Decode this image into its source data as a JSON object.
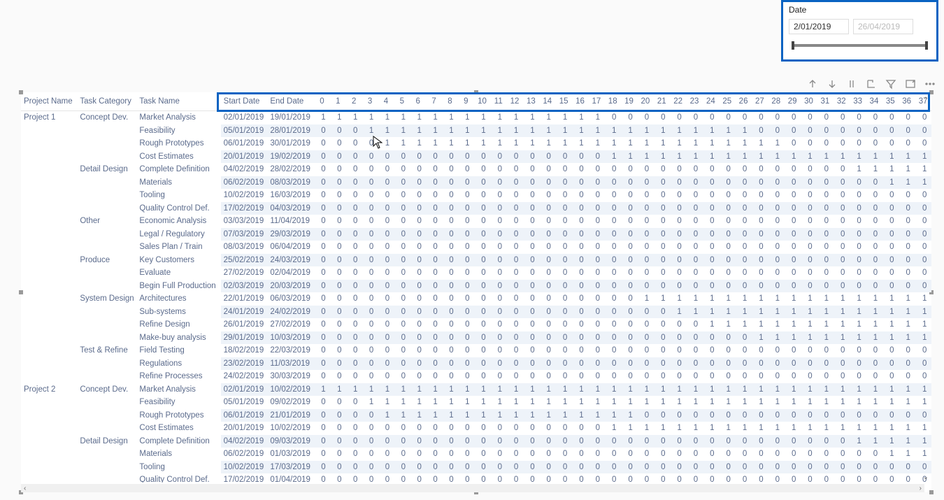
{
  "slicer": {
    "label": "Date",
    "start": "2/01/2019",
    "end": "26/04/2019"
  },
  "toolbar_icons": [
    "drill-up",
    "drill-down-on",
    "expand-down",
    "drill-through",
    "show-data",
    "focus-mode",
    "filter",
    "copy",
    "more"
  ],
  "headers": {
    "project": "Project Name",
    "category": "Task Category",
    "task": "Task Name",
    "start": "Start Date",
    "end": "End Date"
  },
  "num_cols": [
    "0",
    "1",
    "2",
    "3",
    "4",
    "5",
    "6",
    "7",
    "8",
    "9",
    "10",
    "11",
    "12",
    "13",
    "14",
    "15",
    "16",
    "17",
    "18",
    "19",
    "20",
    "21",
    "22",
    "23",
    "24",
    "25",
    "26",
    "27",
    "28",
    "29",
    "30",
    "31",
    "32",
    "33",
    "34",
    "35",
    "36",
    "37"
  ],
  "rows": [
    {
      "pn": "Project 1",
      "cat": "Concept Dev.",
      "task": "Market Analysis",
      "sd": "02/01/2019",
      "ed": "19/01/2019",
      "alt": false,
      "v": [
        1,
        1,
        1,
        1,
        1,
        1,
        1,
        1,
        1,
        1,
        1,
        1,
        1,
        1,
        1,
        1,
        1,
        1,
        0,
        0,
        0,
        0,
        0,
        0,
        0,
        0,
        0,
        0,
        0,
        0,
        0,
        0,
        0,
        0,
        0,
        0,
        0,
        0
      ]
    },
    {
      "pn": "",
      "cat": "",
      "task": "Feasibility",
      "sd": "05/01/2019",
      "ed": "28/01/2019",
      "alt": true,
      "v": [
        0,
        0,
        0,
        1,
        1,
        1,
        1,
        1,
        1,
        1,
        1,
        1,
        1,
        1,
        1,
        1,
        1,
        1,
        1,
        1,
        1,
        1,
        1,
        1,
        1,
        1,
        1,
        0,
        0,
        0,
        0,
        0,
        0,
        0,
        0,
        0,
        0,
        0
      ]
    },
    {
      "pn": "",
      "cat": "",
      "task": "Rough Prototypes",
      "sd": "06/01/2019",
      "ed": "30/01/2019",
      "alt": false,
      "v": [
        0,
        0,
        0,
        0,
        1,
        1,
        1,
        1,
        1,
        1,
        1,
        1,
        1,
        1,
        1,
        1,
        1,
        1,
        1,
        1,
        1,
        1,
        1,
        1,
        1,
        1,
        1,
        1,
        1,
        0,
        0,
        0,
        0,
        0,
        0,
        0,
        0,
        0
      ]
    },
    {
      "pn": "",
      "cat": "",
      "task": "Cost Estimates",
      "sd": "20/01/2019",
      "ed": "19/02/2019",
      "alt": true,
      "v": [
        0,
        0,
        0,
        0,
        0,
        0,
        0,
        0,
        0,
        0,
        0,
        0,
        0,
        0,
        0,
        0,
        0,
        0,
        1,
        1,
        1,
        1,
        1,
        1,
        1,
        1,
        1,
        1,
        1,
        1,
        1,
        1,
        1,
        1,
        1,
        1,
        1,
        1
      ]
    },
    {
      "pn": "",
      "cat": "Detail Design",
      "task": "Complete Definition",
      "sd": "04/02/2019",
      "ed": "28/02/2019",
      "alt": false,
      "v": [
        0,
        0,
        0,
        0,
        0,
        0,
        0,
        0,
        0,
        0,
        0,
        0,
        0,
        0,
        0,
        0,
        0,
        0,
        0,
        0,
        0,
        0,
        0,
        0,
        0,
        0,
        0,
        0,
        0,
        0,
        0,
        0,
        0,
        1,
        1,
        1,
        1,
        1
      ]
    },
    {
      "pn": "",
      "cat": "",
      "task": "Materials",
      "sd": "06/02/2019",
      "ed": "08/03/2019",
      "alt": true,
      "v": [
        0,
        0,
        0,
        0,
        0,
        0,
        0,
        0,
        0,
        0,
        0,
        0,
        0,
        0,
        0,
        0,
        0,
        0,
        0,
        0,
        0,
        0,
        0,
        0,
        0,
        0,
        0,
        0,
        0,
        0,
        0,
        0,
        0,
        0,
        0,
        1,
        1,
        1
      ]
    },
    {
      "pn": "",
      "cat": "",
      "task": "Tooling",
      "sd": "10/02/2019",
      "ed": "16/03/2019",
      "alt": false,
      "v": [
        0,
        0,
        0,
        0,
        0,
        0,
        0,
        0,
        0,
        0,
        0,
        0,
        0,
        0,
        0,
        0,
        0,
        0,
        0,
        0,
        0,
        0,
        0,
        0,
        0,
        0,
        0,
        0,
        0,
        0,
        0,
        0,
        0,
        0,
        0,
        0,
        0,
        0
      ]
    },
    {
      "pn": "",
      "cat": "",
      "task": "Quality Control Def.",
      "sd": "17/02/2019",
      "ed": "04/03/2019",
      "alt": true,
      "v": [
        0,
        0,
        0,
        0,
        0,
        0,
        0,
        0,
        0,
        0,
        0,
        0,
        0,
        0,
        0,
        0,
        0,
        0,
        0,
        0,
        0,
        0,
        0,
        0,
        0,
        0,
        0,
        0,
        0,
        0,
        0,
        0,
        0,
        0,
        0,
        0,
        0,
        0
      ]
    },
    {
      "pn": "",
      "cat": "Other",
      "task": "Economic Analysis",
      "sd": "03/03/2019",
      "ed": "11/04/2019",
      "alt": false,
      "v": [
        0,
        0,
        0,
        0,
        0,
        0,
        0,
        0,
        0,
        0,
        0,
        0,
        0,
        0,
        0,
        0,
        0,
        0,
        0,
        0,
        0,
        0,
        0,
        0,
        0,
        0,
        0,
        0,
        0,
        0,
        0,
        0,
        0,
        0,
        0,
        0,
        0,
        0
      ]
    },
    {
      "pn": "",
      "cat": "",
      "task": "Legal / Regulatory",
      "sd": "07/03/2019",
      "ed": "29/03/2019",
      "alt": true,
      "v": [
        0,
        0,
        0,
        0,
        0,
        0,
        0,
        0,
        0,
        0,
        0,
        0,
        0,
        0,
        0,
        0,
        0,
        0,
        0,
        0,
        0,
        0,
        0,
        0,
        0,
        0,
        0,
        0,
        0,
        0,
        0,
        0,
        0,
        0,
        0,
        0,
        0,
        0
      ]
    },
    {
      "pn": "",
      "cat": "",
      "task": "Sales Plan / Train",
      "sd": "08/03/2019",
      "ed": "06/04/2019",
      "alt": false,
      "v": [
        0,
        0,
        0,
        0,
        0,
        0,
        0,
        0,
        0,
        0,
        0,
        0,
        0,
        0,
        0,
        0,
        0,
        0,
        0,
        0,
        0,
        0,
        0,
        0,
        0,
        0,
        0,
        0,
        0,
        0,
        0,
        0,
        0,
        0,
        0,
        0,
        0,
        0
      ]
    },
    {
      "pn": "",
      "cat": "Produce",
      "task": "Key Customers",
      "sd": "25/02/2019",
      "ed": "24/03/2019",
      "alt": true,
      "v": [
        0,
        0,
        0,
        0,
        0,
        0,
        0,
        0,
        0,
        0,
        0,
        0,
        0,
        0,
        0,
        0,
        0,
        0,
        0,
        0,
        0,
        0,
        0,
        0,
        0,
        0,
        0,
        0,
        0,
        0,
        0,
        0,
        0,
        0,
        0,
        0,
        0,
        0
      ]
    },
    {
      "pn": "",
      "cat": "",
      "task": "Evaluate",
      "sd": "27/02/2019",
      "ed": "02/04/2019",
      "alt": false,
      "v": [
        0,
        0,
        0,
        0,
        0,
        0,
        0,
        0,
        0,
        0,
        0,
        0,
        0,
        0,
        0,
        0,
        0,
        0,
        0,
        0,
        0,
        0,
        0,
        0,
        0,
        0,
        0,
        0,
        0,
        0,
        0,
        0,
        0,
        0,
        0,
        0,
        0,
        0
      ]
    },
    {
      "pn": "",
      "cat": "",
      "task": "Begin Full Production",
      "sd": "02/03/2019",
      "ed": "20/03/2019",
      "alt": true,
      "v": [
        0,
        0,
        0,
        0,
        0,
        0,
        0,
        0,
        0,
        0,
        0,
        0,
        0,
        0,
        0,
        0,
        0,
        0,
        0,
        0,
        0,
        0,
        0,
        0,
        0,
        0,
        0,
        0,
        0,
        0,
        0,
        0,
        0,
        0,
        0,
        0,
        0,
        0
      ]
    },
    {
      "pn": "",
      "cat": "System Design",
      "task": "Architectures",
      "sd": "22/01/2019",
      "ed": "06/03/2019",
      "alt": false,
      "v": [
        0,
        0,
        0,
        0,
        0,
        0,
        0,
        0,
        0,
        0,
        0,
        0,
        0,
        0,
        0,
        0,
        0,
        0,
        0,
        0,
        1,
        1,
        1,
        1,
        1,
        1,
        1,
        1,
        1,
        1,
        1,
        1,
        1,
        1,
        1,
        1,
        1,
        1
      ]
    },
    {
      "pn": "",
      "cat": "",
      "task": "Sub-systems",
      "sd": "24/01/2019",
      "ed": "24/02/2019",
      "alt": true,
      "v": [
        0,
        0,
        0,
        0,
        0,
        0,
        0,
        0,
        0,
        0,
        0,
        0,
        0,
        0,
        0,
        0,
        0,
        0,
        0,
        0,
        0,
        0,
        1,
        1,
        1,
        1,
        1,
        1,
        1,
        1,
        1,
        1,
        1,
        1,
        1,
        1,
        1,
        1
      ]
    },
    {
      "pn": "",
      "cat": "",
      "task": "Refine Design",
      "sd": "26/01/2019",
      "ed": "27/02/2019",
      "alt": false,
      "v": [
        0,
        0,
        0,
        0,
        0,
        0,
        0,
        0,
        0,
        0,
        0,
        0,
        0,
        0,
        0,
        0,
        0,
        0,
        0,
        0,
        0,
        0,
        0,
        0,
        1,
        1,
        1,
        1,
        1,
        1,
        1,
        1,
        1,
        1,
        1,
        1,
        1,
        1
      ]
    },
    {
      "pn": "",
      "cat": "",
      "task": "Make-buy analysis",
      "sd": "29/01/2019",
      "ed": "10/03/2019",
      "alt": true,
      "v": [
        0,
        0,
        0,
        0,
        0,
        0,
        0,
        0,
        0,
        0,
        0,
        0,
        0,
        0,
        0,
        0,
        0,
        0,
        0,
        0,
        0,
        0,
        0,
        0,
        0,
        0,
        0,
        1,
        1,
        1,
        1,
        1,
        1,
        1,
        1,
        1,
        1,
        1
      ]
    },
    {
      "pn": "",
      "cat": "Test & Refine",
      "task": "Field Testing",
      "sd": "18/02/2019",
      "ed": "22/03/2019",
      "alt": false,
      "v": [
        0,
        0,
        0,
        0,
        0,
        0,
        0,
        0,
        0,
        0,
        0,
        0,
        0,
        0,
        0,
        0,
        0,
        0,
        0,
        0,
        0,
        0,
        0,
        0,
        0,
        0,
        0,
        0,
        0,
        0,
        0,
        0,
        0,
        0,
        0,
        0,
        0,
        0
      ]
    },
    {
      "pn": "",
      "cat": "",
      "task": "Regulations",
      "sd": "23/02/2019",
      "ed": "11/03/2019",
      "alt": true,
      "v": [
        0,
        0,
        0,
        0,
        0,
        0,
        0,
        0,
        0,
        0,
        0,
        0,
        0,
        0,
        0,
        0,
        0,
        0,
        0,
        0,
        0,
        0,
        0,
        0,
        0,
        0,
        0,
        0,
        0,
        0,
        0,
        0,
        0,
        0,
        0,
        0,
        0,
        0
      ]
    },
    {
      "pn": "",
      "cat": "",
      "task": "Refine Processes",
      "sd": "24/02/2019",
      "ed": "30/03/2019",
      "alt": false,
      "v": [
        0,
        0,
        0,
        0,
        0,
        0,
        0,
        0,
        0,
        0,
        0,
        0,
        0,
        0,
        0,
        0,
        0,
        0,
        0,
        0,
        0,
        0,
        0,
        0,
        0,
        0,
        0,
        0,
        0,
        0,
        0,
        0,
        0,
        0,
        0,
        0,
        0,
        0
      ]
    },
    {
      "pn": "Project 2",
      "cat": "Concept Dev.",
      "task": "Market Analysis",
      "sd": "02/01/2019",
      "ed": "10/02/2019",
      "alt": true,
      "v": [
        1,
        1,
        1,
        1,
        1,
        1,
        1,
        1,
        1,
        1,
        1,
        1,
        1,
        1,
        1,
        1,
        1,
        1,
        1,
        1,
        1,
        1,
        1,
        1,
        1,
        1,
        1,
        1,
        1,
        1,
        1,
        1,
        1,
        1,
        1,
        1,
        1,
        1
      ]
    },
    {
      "pn": "",
      "cat": "",
      "task": "Feasibility",
      "sd": "05/01/2019",
      "ed": "09/02/2019",
      "alt": false,
      "v": [
        0,
        0,
        0,
        1,
        1,
        1,
        1,
        1,
        1,
        1,
        1,
        1,
        1,
        1,
        1,
        1,
        1,
        1,
        1,
        1,
        1,
        1,
        1,
        1,
        1,
        1,
        1,
        1,
        1,
        1,
        1,
        1,
        1,
        1,
        1,
        1,
        1,
        1
      ]
    },
    {
      "pn": "",
      "cat": "",
      "task": "Rough Prototypes",
      "sd": "06/01/2019",
      "ed": "21/01/2019",
      "alt": true,
      "v": [
        0,
        0,
        0,
        0,
        1,
        1,
        1,
        1,
        1,
        1,
        1,
        1,
        1,
        1,
        1,
        1,
        1,
        1,
        1,
        1,
        0,
        0,
        0,
        0,
        0,
        0,
        0,
        0,
        0,
        0,
        0,
        0,
        0,
        0,
        0,
        0,
        0,
        0
      ]
    },
    {
      "pn": "",
      "cat": "",
      "task": "Cost Estimates",
      "sd": "20/01/2019",
      "ed": "10/02/2019",
      "alt": false,
      "v": [
        0,
        0,
        0,
        0,
        0,
        0,
        0,
        0,
        0,
        0,
        0,
        0,
        0,
        0,
        0,
        0,
        0,
        0,
        1,
        1,
        1,
        1,
        1,
        1,
        1,
        1,
        1,
        1,
        1,
        1,
        1,
        1,
        1,
        1,
        1,
        1,
        1,
        1
      ]
    },
    {
      "pn": "",
      "cat": "Detail Design",
      "task": "Complete Definition",
      "sd": "04/02/2019",
      "ed": "09/03/2019",
      "alt": true,
      "v": [
        0,
        0,
        0,
        0,
        0,
        0,
        0,
        0,
        0,
        0,
        0,
        0,
        0,
        0,
        0,
        0,
        0,
        0,
        0,
        0,
        0,
        0,
        0,
        0,
        0,
        0,
        0,
        0,
        0,
        0,
        0,
        0,
        0,
        1,
        1,
        1,
        1,
        1
      ]
    },
    {
      "pn": "",
      "cat": "",
      "task": "Materials",
      "sd": "06/02/2019",
      "ed": "01/03/2019",
      "alt": false,
      "v": [
        0,
        0,
        0,
        0,
        0,
        0,
        0,
        0,
        0,
        0,
        0,
        0,
        0,
        0,
        0,
        0,
        0,
        0,
        0,
        0,
        0,
        0,
        0,
        0,
        0,
        0,
        0,
        0,
        0,
        0,
        0,
        0,
        0,
        0,
        0,
        1,
        1,
        1
      ]
    },
    {
      "pn": "",
      "cat": "",
      "task": "Tooling",
      "sd": "10/02/2019",
      "ed": "17/03/2019",
      "alt": true,
      "v": [
        0,
        0,
        0,
        0,
        0,
        0,
        0,
        0,
        0,
        0,
        0,
        0,
        0,
        0,
        0,
        0,
        0,
        0,
        0,
        0,
        0,
        0,
        0,
        0,
        0,
        0,
        0,
        0,
        0,
        0,
        0,
        0,
        0,
        0,
        0,
        0,
        0,
        0
      ]
    },
    {
      "pn": "",
      "cat": "",
      "task": "Quality Control Def.",
      "sd": "17/02/2019",
      "ed": "01/04/2019",
      "alt": false,
      "v": [
        0,
        0,
        0,
        0,
        0,
        0,
        0,
        0,
        0,
        0,
        0,
        0,
        0,
        0,
        0,
        0,
        0,
        0,
        0,
        0,
        0,
        0,
        0,
        0,
        0,
        0,
        0,
        0,
        0,
        0,
        0,
        0,
        0,
        0,
        0,
        0,
        0,
        0
      ]
    }
  ]
}
